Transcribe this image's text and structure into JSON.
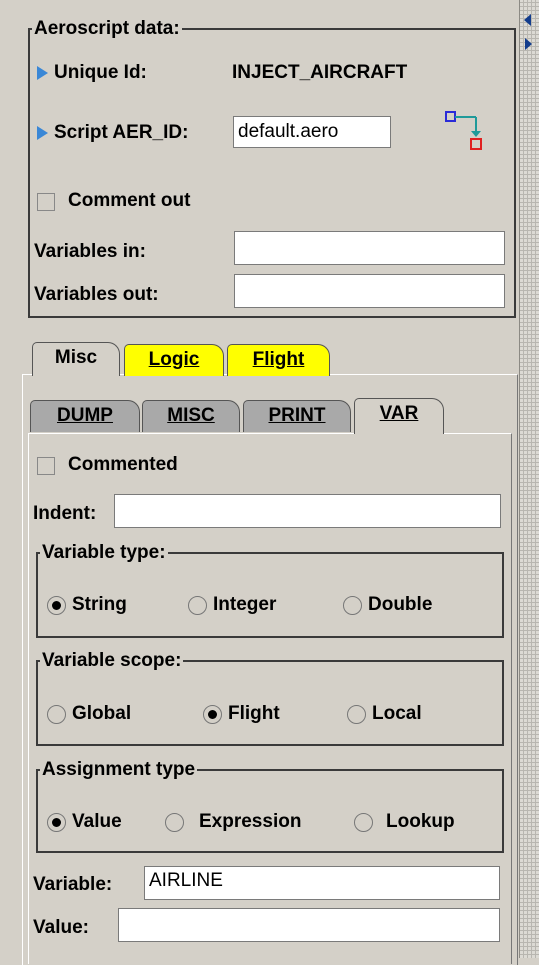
{
  "aeroscript": {
    "legend": "Aeroscript data:",
    "unique_id_label": "Unique Id:",
    "unique_id_value": "INJECT_AIRCRAFT",
    "script_label": "Script AER_ID:",
    "script_value": "default.aero",
    "comment_out_label": "Comment out",
    "vars_in_label": "Variables in:",
    "vars_in_value": "",
    "vars_out_label": "Variables out:",
    "vars_out_value": ""
  },
  "outer_tabs": [
    {
      "label": "Misc",
      "active": true,
      "color": "#d4d0c8"
    },
    {
      "label": "Logic",
      "active": false,
      "color": "#ffff00"
    },
    {
      "label": "Flight",
      "active": false,
      "color": "#ffff00"
    }
  ],
  "inner_tabs": [
    {
      "label": "DUMP",
      "active": false
    },
    {
      "label": "MISC",
      "active": false
    },
    {
      "label": "PRINT",
      "active": false
    },
    {
      "label": "VAR",
      "active": true
    }
  ],
  "var_panel": {
    "commented_label": "Commented",
    "indent_label": "Indent:",
    "indent_value": "",
    "variable_type": {
      "legend": "Variable type:",
      "options": [
        "String",
        "Integer",
        "Double"
      ],
      "selected": "String"
    },
    "variable_scope": {
      "legend": "Variable scope:",
      "options": [
        "Global",
        "Flight",
        "Local"
      ],
      "selected": "Flight"
    },
    "assignment_type": {
      "legend": "Assignment type",
      "options": [
        "Value",
        "Expression",
        "Lookup"
      ],
      "selected": "Value"
    },
    "variable_label": "Variable:",
    "variable_value": "AIRLINE",
    "value_label": "Value:",
    "value_value": ""
  },
  "icons": {
    "flow_icon": "flowchart-connector-icon",
    "arrow_color": "#3a87d6",
    "tab_highlight": "#ffff00"
  }
}
